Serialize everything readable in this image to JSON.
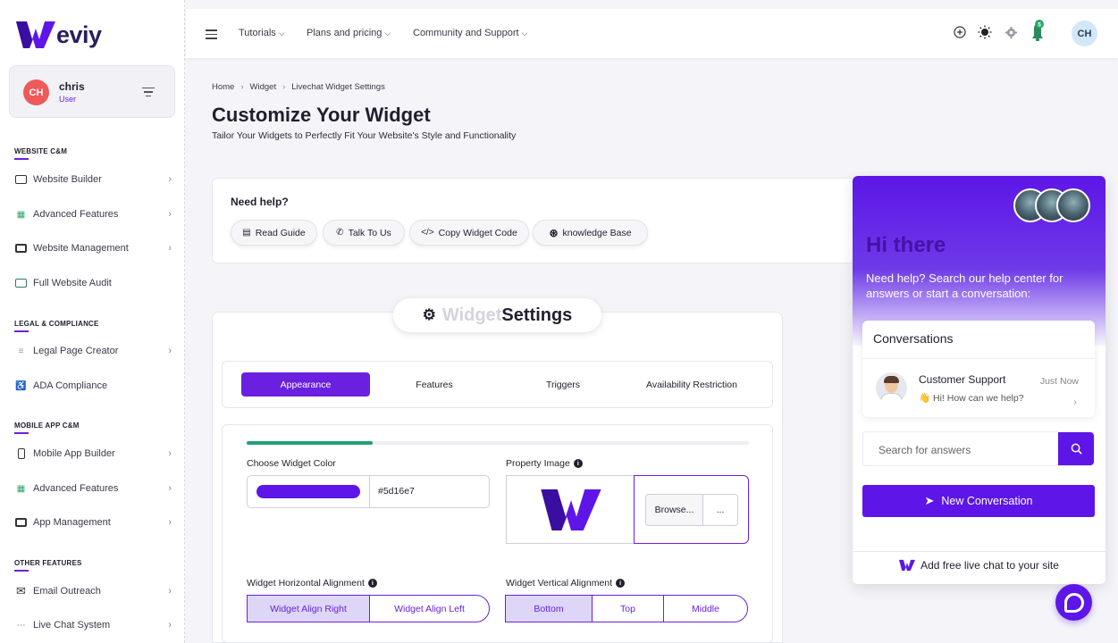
{
  "brand": {
    "logo_text": "eviy",
    "accent": "#6b1fe0",
    "widget_color": "#5d16e7"
  },
  "user": {
    "initials": "CH",
    "name": "chris",
    "role": "User"
  },
  "sidebar": {
    "sections": [
      {
        "title": "WEBSITE C&M",
        "items": [
          {
            "label": "Website Builder",
            "icon": "browser-window-icon",
            "has_chevron": true
          },
          {
            "label": "Advanced Features",
            "icon": "grid-colored-icon",
            "has_chevron": true
          },
          {
            "label": "Website Management",
            "icon": "window-manage-icon",
            "has_chevron": true
          },
          {
            "label": "Full Website Audit",
            "icon": "audit-icon",
            "has_chevron": false
          }
        ]
      },
      {
        "title": "LEGAL & COMPLIANCE",
        "items": [
          {
            "label": "Legal Page Creator",
            "icon": "document-icon",
            "has_chevron": true
          },
          {
            "label": "ADA Compliance",
            "icon": "accessibility-icon",
            "has_chevron": false
          }
        ]
      },
      {
        "title": "MOBILE APP C&M",
        "items": [
          {
            "label": "Mobile App Builder",
            "icon": "mobile-icon",
            "has_chevron": true
          },
          {
            "label": "Advanced Features",
            "icon": "grid-colored-icon",
            "has_chevron": true
          },
          {
            "label": "App Management",
            "icon": "window-manage-icon",
            "has_chevron": true
          }
        ]
      },
      {
        "title": "OTHER FEATURES",
        "items": [
          {
            "label": "Email Outreach",
            "icon": "email-icon",
            "has_chevron": true
          },
          {
            "label": "Live Chat System",
            "icon": "chat-dots-icon",
            "has_chevron": true
          }
        ]
      }
    ]
  },
  "topbar": {
    "menus": [
      "Tutorials",
      "Plans and pricing",
      "Community and Support"
    ],
    "notification_count": "5",
    "avatar_initials": "CH"
  },
  "breadcrumb": [
    "Home",
    "Widget",
    "Livechat Widget Settings"
  ],
  "page": {
    "title": "Customize Your Widget",
    "subtitle": "Tailor Your Widgets to Perfectly Fit Your Website's Style and Functionality"
  },
  "help": {
    "title": "Need help?",
    "buttons": [
      "Read Guide",
      "Talk To Us",
      "Copy Widget Code",
      "knowledge Base"
    ]
  },
  "settings": {
    "title_faded": "Widget",
    "title_bold": "Settings",
    "tabs": [
      "Appearance",
      "Features",
      "Triggers",
      "Availability Restriction"
    ],
    "active_tab": "Appearance",
    "progress_percent": 25,
    "color_label": "Choose Widget Color",
    "color_value": "#5d16e7",
    "property_image_label": "Property Image",
    "browse_label": "Browse...",
    "more_label": "...",
    "h_align_label": "Widget Horizontal Alignment",
    "h_align_options": [
      "Widget Align Right",
      "Widget Align Left"
    ],
    "h_align_selected": "Widget Align Right",
    "v_align_label": "Widget Vertical Alignment",
    "v_align_options": [
      "Bottom",
      "Top",
      "Middle"
    ],
    "v_align_selected": "Bottom"
  },
  "chat_widget": {
    "greeting": "Hi there",
    "description": "Need help? Search our help center for answers or start a conversation:",
    "conversations_title": "Conversations",
    "agent_name": "Customer Support",
    "agent_time": "Just Now",
    "agent_message": "👋 Hi! How can we help?",
    "search_placeholder": "Search for answers",
    "new_conversation": "New Conversation",
    "footer": "Add free live chat to your site"
  }
}
